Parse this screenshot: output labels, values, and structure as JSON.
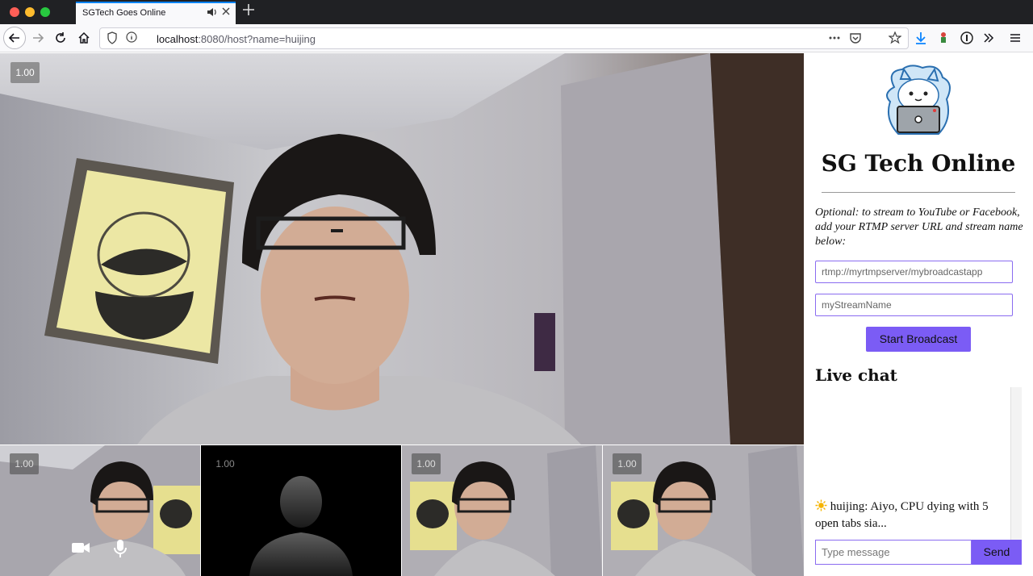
{
  "browser": {
    "tab_title": "SGTech Goes Online",
    "url_host": "localhost",
    "url_rest": ":8080/host?name=huijing",
    "icons": [
      "back-icon",
      "forward-icon",
      "reload-icon",
      "home-icon",
      "shield-icon",
      "info-icon",
      "more-icon",
      "pocket-icon",
      "star-icon",
      "download-icon",
      "extension-icon",
      "password-icon",
      "overflow-icon",
      "menu-icon"
    ]
  },
  "main_video": {
    "zoom_label": "1.00"
  },
  "thumbnails": [
    {
      "zoom_label": "1.00",
      "kind": "camera",
      "controls": [
        "video-camera-icon",
        "microphone-icon"
      ]
    },
    {
      "zoom_label": "1.00",
      "kind": "placeholder"
    },
    {
      "zoom_label": "1.00",
      "kind": "camera"
    },
    {
      "zoom_label": "1.00",
      "kind": "camera"
    }
  ],
  "panel": {
    "title": "SG Tech Online",
    "intro": "Optional: to stream to YouTube or Facebook, add your RTMP server URL and stream name below:",
    "rtmp_placeholder": "rtmp://myrtmpserver/mybroadcastapp",
    "stream_placeholder": "myStreamName",
    "broadcast_label": "Start Broadcast",
    "chat_heading": "Live chat",
    "chat_message": {
      "icon": "sun-icon",
      "text": "huijing: Aiyo, CPU dying with 5 open tabs sia..."
    },
    "message_placeholder": "Type message",
    "send_label": "Send"
  },
  "colors": {
    "accent": "#7b5cf5",
    "tab_accent": "#0a84ff",
    "chrome_dark": "#202124"
  }
}
